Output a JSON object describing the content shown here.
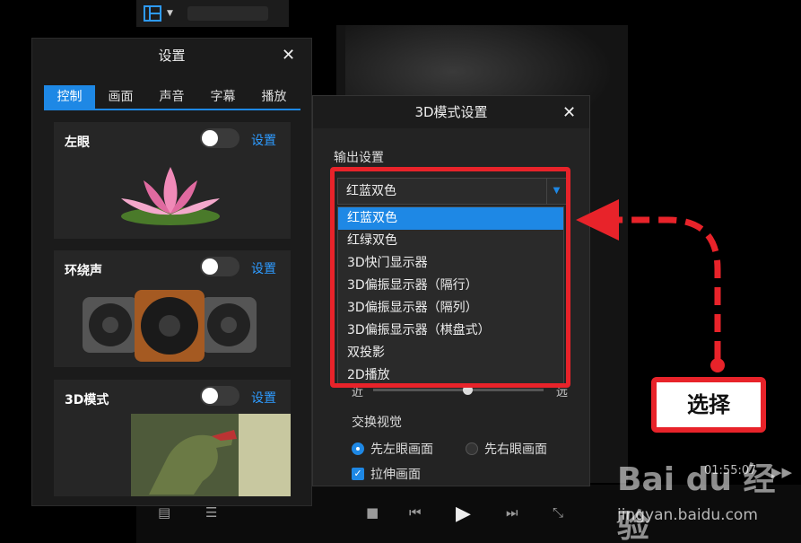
{
  "player": {
    "time": "01:55:07"
  },
  "settings": {
    "title": "设置",
    "close": "✕",
    "tabs": [
      "控制",
      "画面",
      "声音",
      "字幕",
      "播放"
    ],
    "active_tab": "控制",
    "cards": [
      {
        "label": "左眼",
        "set": "设置",
        "toggle_on": false,
        "image": "lotus-flower"
      },
      {
        "label": "环绕声",
        "set": "设置",
        "toggle_on": false,
        "image": "speakers"
      },
      {
        "label": "3D模式",
        "set": "设置",
        "toggle_on": false,
        "image": "dinosaur"
      }
    ]
  },
  "dialog": {
    "title": "3D模式设置",
    "close": "✕",
    "output_label": "输出设置",
    "select_value": "红蓝双色",
    "options": [
      "红蓝双色",
      "红绿双色",
      "3D快门显示器",
      "3D偏振显示器（隔行）",
      "3D偏振显示器（隔列）",
      "3D偏振显示器（棋盘式）",
      "双投影",
      "2D播放"
    ],
    "selected_index": 0,
    "depth_near": "近",
    "depth_far": "远",
    "swap_label": "交换视觉",
    "radio_left": "先左眼画面",
    "radio_right": "先右眼画面",
    "radio_selected": "left",
    "stretch_label": "拉伸画面",
    "stretch_checked": true
  },
  "annotation": {
    "callout": "选择",
    "color": "#e8232a"
  },
  "watermark": {
    "brand": "Bai du 经验",
    "url": "jingyan.baidu.com"
  }
}
